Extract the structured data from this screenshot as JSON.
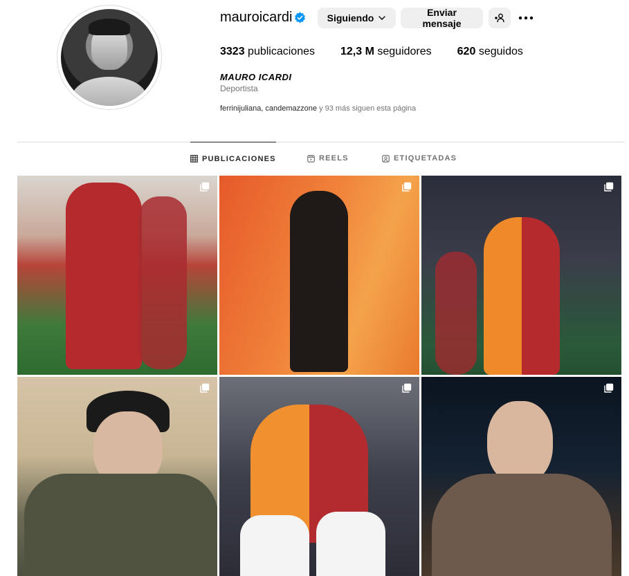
{
  "profile": {
    "username": "mauroicardi",
    "verified": true,
    "full_name": "MAURO ICARDI",
    "category": "Deportista",
    "followed_by_names": "ferrinijuliana, candemazzone",
    "followed_by_rest": " y 93 más siguen esta página"
  },
  "actions": {
    "following_label": "Siguiendo",
    "message_label": "Enviar mensaje"
  },
  "stats": {
    "posts_count": "3323",
    "posts_label": "publicaciones",
    "followers_count": "12,3 M",
    "followers_label": "seguidores",
    "following_count": "620",
    "following_label": "seguidos"
  },
  "tabs": [
    {
      "label": "PUBLICACIONES",
      "icon": "grid-icon",
      "active": true
    },
    {
      "label": "REELS",
      "icon": "reels-icon",
      "active": false
    },
    {
      "label": "ETIQUETADAS",
      "icon": "tagged-icon",
      "active": false
    }
  ],
  "colors": {
    "verified_blue": "#0095f6",
    "button_bg": "#efefef",
    "secondary_text": "#737373"
  },
  "posts": [
    {
      "type": "carousel"
    },
    {
      "type": "carousel"
    },
    {
      "type": "carousel"
    },
    {
      "type": "carousel"
    },
    {
      "type": "carousel"
    },
    {
      "type": "carousel"
    }
  ]
}
